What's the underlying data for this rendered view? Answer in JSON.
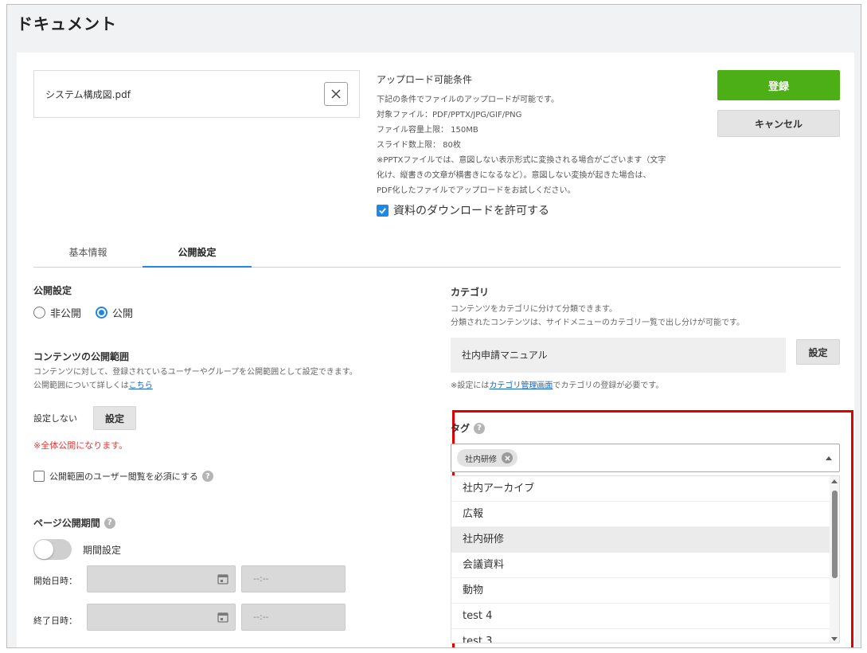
{
  "page": {
    "title": "ドキュメント"
  },
  "upload": {
    "file_name": "システム構成図.pdf",
    "clear_icon": "close-icon"
  },
  "conditions": {
    "title": "アップロード可能条件",
    "lines": [
      "下記の条件でファイルのアップロードが可能です。",
      "対象ファイル：PDF/PPTX/JPG/GIF/PNG",
      "ファイル容量上限： 150MB",
      "スライド数上限： 80枚",
      "※PPTXファイルでは、意図しない表示形式に変換される場合がございます（文字",
      "化け、縦書きの文章が横書きになるなど）。意図しない変換が起きた場合は、",
      "PDF化したファイルでアップロードをお試しください。"
    ],
    "download_label": "資料のダウンロードを許可する",
    "download_checked": true
  },
  "actions": {
    "register": "登録",
    "cancel": "キャンセル"
  },
  "tabs": [
    {
      "label": "基本情報",
      "active": false
    },
    {
      "label": "公開設定",
      "active": true
    }
  ],
  "publish": {
    "label": "公開設定",
    "options": [
      "非公開",
      "公開"
    ],
    "selected": "公開"
  },
  "scope": {
    "label": "コンテンツの公開範囲",
    "desc1": "コンテンツに対して、登録されているユーザーやグループを公開範囲として設定できます。",
    "desc2_prefix": "公開範囲について詳しくは",
    "desc2_link": "こちら",
    "status": "設定しない",
    "set_button": "設定",
    "warning": "※全体公開になります。",
    "require_view_label": "公開範囲のユーザー閲覧を必須にする"
  },
  "period": {
    "label": "ページ公開期間",
    "toggle_label": "期間設定",
    "start_label": "開始日時：",
    "end_label": "終了日時：",
    "time_placeholder": "--:--"
  },
  "category": {
    "label": "カテゴリ",
    "desc1": "コンテンツをカテゴリに分けて分類できます。",
    "desc2": "分類されたコンテンツは、サイドメニューのカテゴリ一覧で出し分けが可能です。",
    "value": "社内申請マニュアル",
    "set_button": "設定",
    "note_prefix": "※設定には",
    "note_link": "カテゴリ管理画面",
    "note_suffix": "でカテゴリの登録が必要です。"
  },
  "tag": {
    "label": "タグ",
    "selected_chip": "社内研修",
    "options": [
      "社内アーカイブ",
      "広報",
      "社内研修",
      "会議資料",
      "動物",
      "test 4",
      "test 3"
    ],
    "highlighted": "社内研修"
  },
  "colors": {
    "accent": "#1e88e5",
    "register": "#4caf16",
    "warning": "#e53935",
    "highlight_border": "#e00000"
  }
}
